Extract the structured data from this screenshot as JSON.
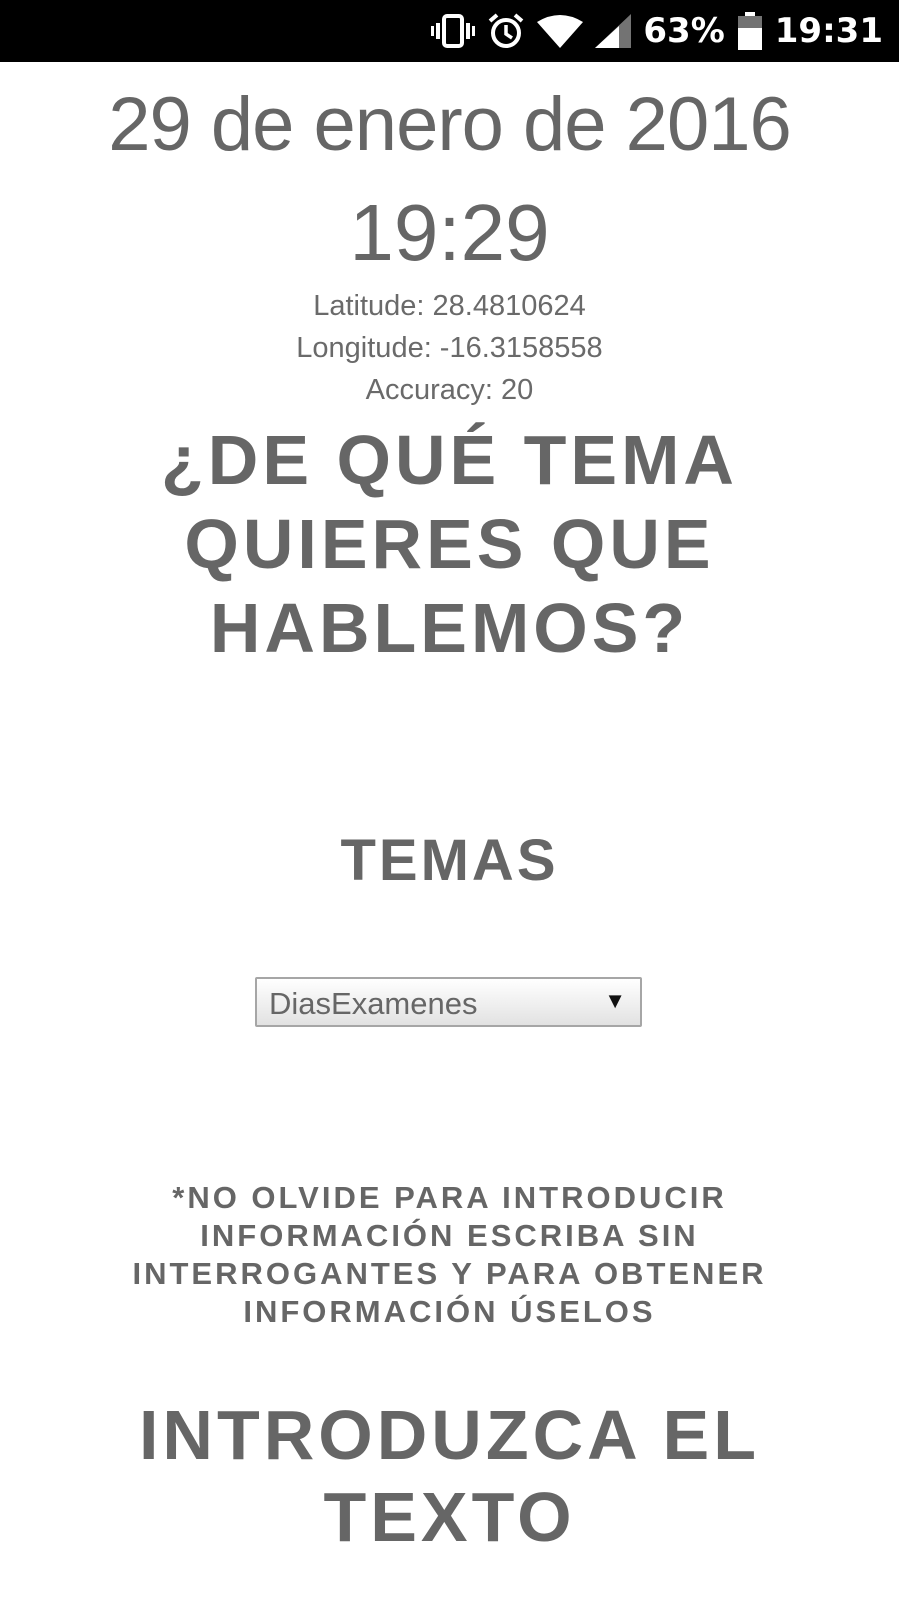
{
  "status_bar": {
    "battery_percent": "63%",
    "clock": "19:31",
    "icons": [
      "vibrate-icon",
      "alarm-icon",
      "wifi-icon",
      "cell-signal-icon",
      "battery-icon"
    ]
  },
  "header": {
    "date": "29 de enero de 2016",
    "time": "19:29"
  },
  "location": {
    "latitude": "Latitude: 28.4810624",
    "longitude": "Longitude: -16.3158558",
    "accuracy": "Accuracy: 20"
  },
  "question": "¿DE QUÉ TEMA QUIERES QUE HABLEMOS?",
  "topics": {
    "title": "TEMAS",
    "selected": "DiasExamenes",
    "arrow": "▼"
  },
  "note": "*NO OLVIDE PARA INTRODUCIR INFORMACIÓN ESCRIBA SIN INTERROGANTES Y PARA OBTENER INFORMACIÓN ÚSELOS",
  "prompt": "INTRODUZCA EL TEXTO",
  "colors": {
    "text": "#666666",
    "status_bar_bg": "#000000",
    "status_bar_fg": "#ffffff"
  }
}
